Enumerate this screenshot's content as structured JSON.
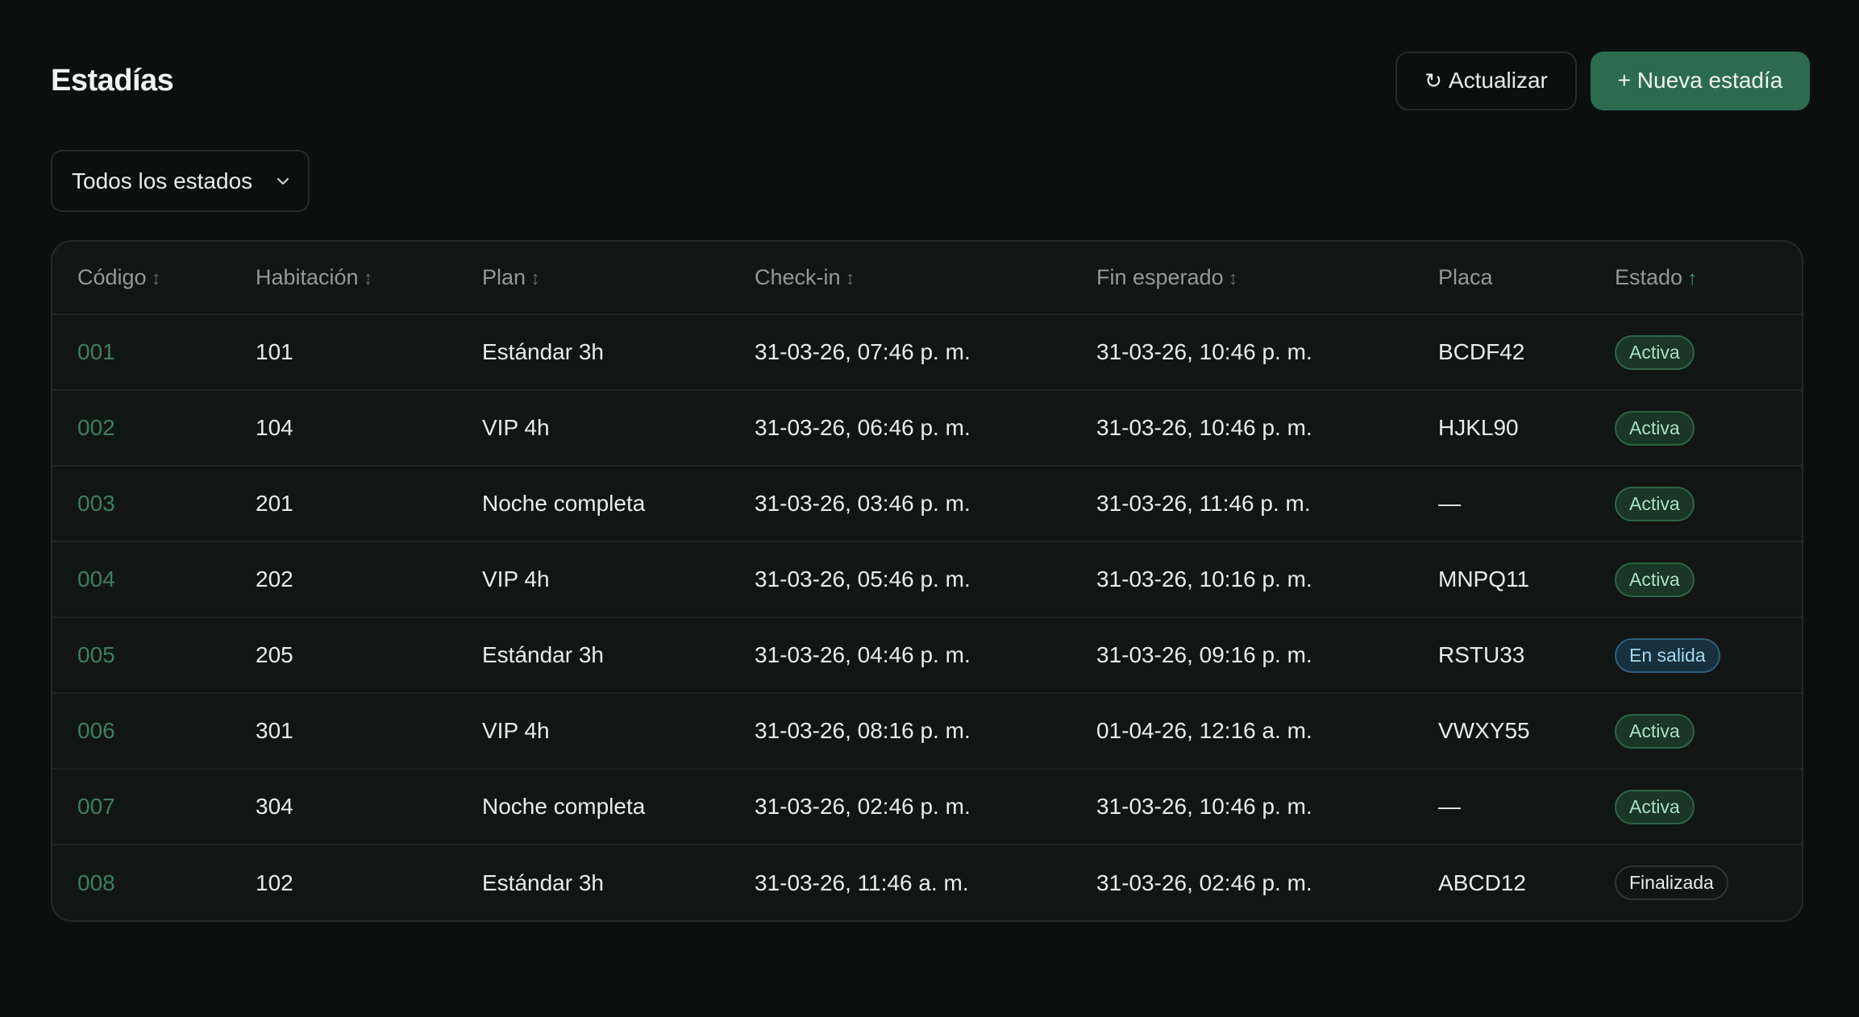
{
  "header": {
    "title": "Estadías",
    "refresh_icon": "↻",
    "refresh_label": "Actualizar",
    "new_label": "+ Nueva estadía"
  },
  "filter": {
    "selected": "Todos los estados",
    "icon": "chevron-down-icon"
  },
  "table": {
    "columns": [
      {
        "label": "Código",
        "sort": "↕"
      },
      {
        "label": "Habitación",
        "sort": "↕"
      },
      {
        "label": "Plan",
        "sort": "↕"
      },
      {
        "label": "Check-in",
        "sort": "↕"
      },
      {
        "label": "Fin esperado",
        "sort": "↕"
      },
      {
        "label": "Placa",
        "sort": ""
      },
      {
        "label": "Estado",
        "sort": "↑"
      }
    ],
    "rows": [
      {
        "code": "001",
        "room": "101",
        "plan": "Estándar 3h",
        "checkin": "31-03-26, 07:46 p. m.",
        "end": "31-03-26, 10:46 p. m.",
        "plate": "BCDF42",
        "status": "Activa",
        "status_type": "active"
      },
      {
        "code": "002",
        "room": "104",
        "plan": "VIP 4h",
        "checkin": "31-03-26, 06:46 p. m.",
        "end": "31-03-26, 10:46 p. m.",
        "plate": "HJKL90",
        "status": "Activa",
        "status_type": "active"
      },
      {
        "code": "003",
        "room": "201",
        "plan": "Noche completa",
        "checkin": "31-03-26, 03:46 p. m.",
        "end": "31-03-26, 11:46 p. m.",
        "plate": "—",
        "status": "Activa",
        "status_type": "active"
      },
      {
        "code": "004",
        "room": "202",
        "plan": "VIP 4h",
        "checkin": "31-03-26, 05:46 p. m.",
        "end": "31-03-26, 10:16 p. m.",
        "plate": "MNPQ11",
        "status": "Activa",
        "status_type": "active"
      },
      {
        "code": "005",
        "room": "205",
        "plan": "Estándar 3h",
        "checkin": "31-03-26, 04:46 p. m.",
        "end": "31-03-26, 09:16 p. m.",
        "plate": "RSTU33",
        "status": "En salida",
        "status_type": "leaving"
      },
      {
        "code": "006",
        "room": "301",
        "plan": "VIP 4h",
        "checkin": "31-03-26, 08:16 p. m.",
        "end": "01-04-26, 12:16 a. m.",
        "plate": "VWXY55",
        "status": "Activa",
        "status_type": "active"
      },
      {
        "code": "007",
        "room": "304",
        "plan": "Noche completa",
        "checkin": "31-03-26, 02:46 p. m.",
        "end": "31-03-26, 10:46 p. m.",
        "plate": "—",
        "status": "Activa",
        "status_type": "active"
      },
      {
        "code": "008",
        "room": "102",
        "plan": "Estándar 3h",
        "checkin": "31-03-26, 11:46 a. m.",
        "end": "31-03-26, 02:46 p. m.",
        "plate": "ABCD12",
        "status": "Finalizada",
        "status_type": "done"
      }
    ]
  },
  "colors": {
    "background": "#0b0f0e",
    "primary": "#2c6b4f",
    "code_link": "#3f7d60",
    "badge_active": "#a9e2bf",
    "badge_leaving": "#a8d7ef"
  }
}
